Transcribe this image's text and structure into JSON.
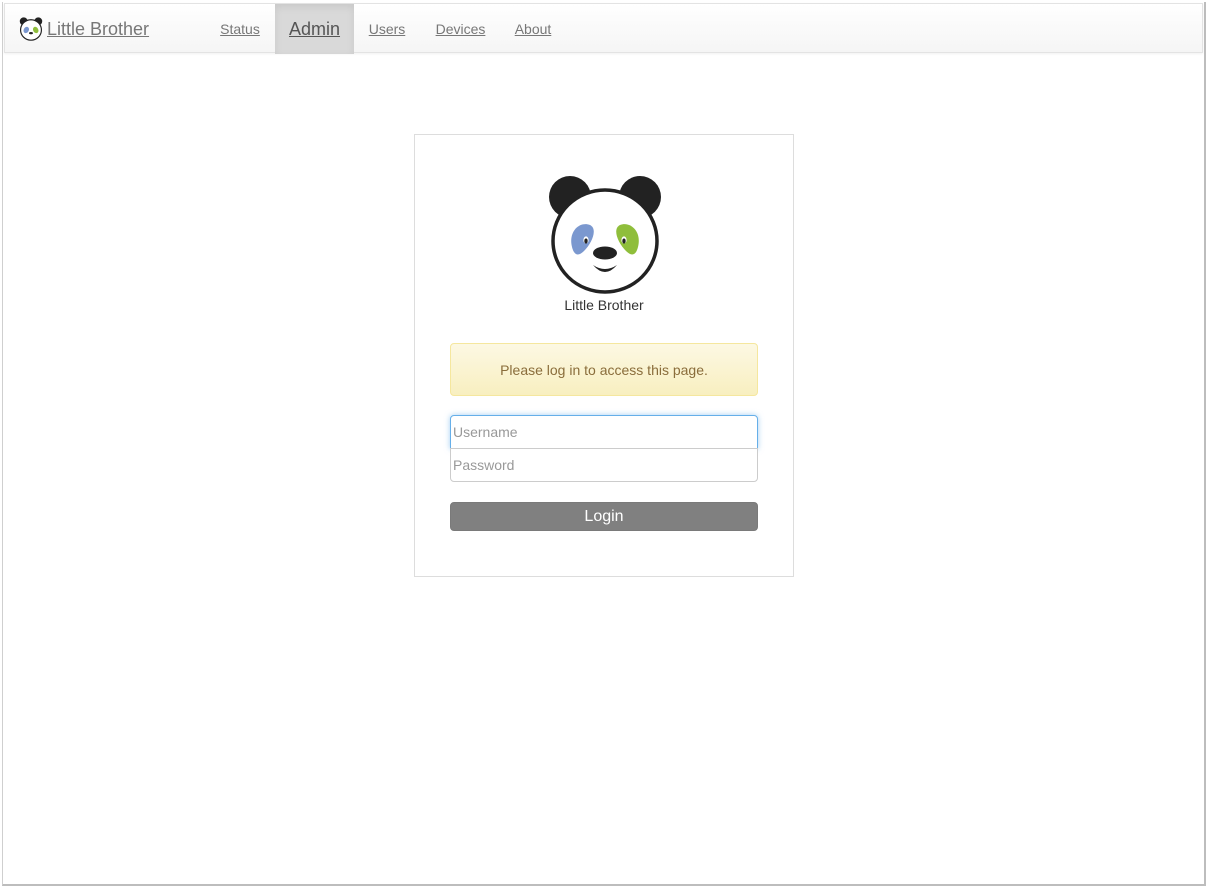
{
  "navbar": {
    "brand_label": "Little Brother",
    "brand_icon": "panda-logo-icon",
    "items": [
      {
        "label": "Status",
        "active": false
      },
      {
        "label": "Admin",
        "active": true
      },
      {
        "label": "Users",
        "active": false
      },
      {
        "label": "Devices",
        "active": false
      },
      {
        "label": "About",
        "active": false
      }
    ]
  },
  "login": {
    "logo_icon": "panda-logo-icon",
    "app_name": "Little Brother",
    "alert_text": "Please log in to access this page.",
    "username": {
      "value": "",
      "placeholder": "Username"
    },
    "password": {
      "value": "",
      "placeholder": "Password"
    },
    "submit_label": "Login"
  },
  "colors": {
    "panda_left_eye": "#7b98cf",
    "panda_right_eye": "#8fbe3b",
    "alert_text": "#8a6d3b",
    "alert_bg": "#fcf8e3",
    "button_bg": "#808080",
    "focus_ring": "#66afe9"
  }
}
